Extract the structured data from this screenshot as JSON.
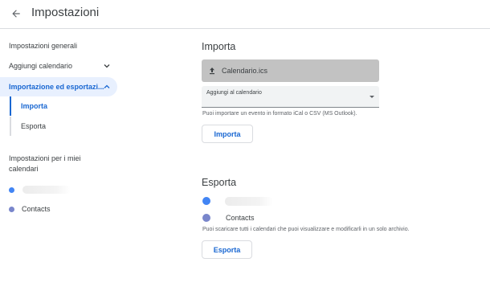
{
  "header": {
    "title": "Impostazioni",
    "back_icon": "arrow-back-icon"
  },
  "sidebar": {
    "items": [
      {
        "label": "Impostazioni generali"
      },
      {
        "label": "Aggiungi calendario",
        "expanded": false
      },
      {
        "label": "Importazione ed esportazi...",
        "expanded": true,
        "active": true
      }
    ],
    "sub_items": [
      {
        "label": "Importa",
        "active": true
      },
      {
        "label": "Esporta",
        "active": false
      }
    ],
    "my_calendars_heading": "Impostazioni per i miei calendari",
    "calendars": [
      {
        "label": "",
        "color": "#4285f4"
      },
      {
        "label": "Contacts",
        "color": "#7986cb"
      }
    ]
  },
  "import": {
    "title": "Importa",
    "file_name": "Calendario.ics",
    "select_label": "Aggiungi al calendario",
    "helper": "Puoi importare un evento in formato iCal o CSV (MS Outlook).",
    "button": "Importa"
  },
  "export": {
    "title": "Esporta",
    "calendars": [
      {
        "label": "",
        "color": "#4285f4"
      },
      {
        "label": "Contacts",
        "color": "#7986cb"
      }
    ],
    "helper": "Puoi scaricare tutti i calendari che puoi visualizzare e modificarli in un solo archivio.",
    "button": "Esporta"
  },
  "colors": {
    "accent": "#1967d2",
    "active_bg": "#e8f0fe",
    "file_bar": "#c2c2c2"
  }
}
